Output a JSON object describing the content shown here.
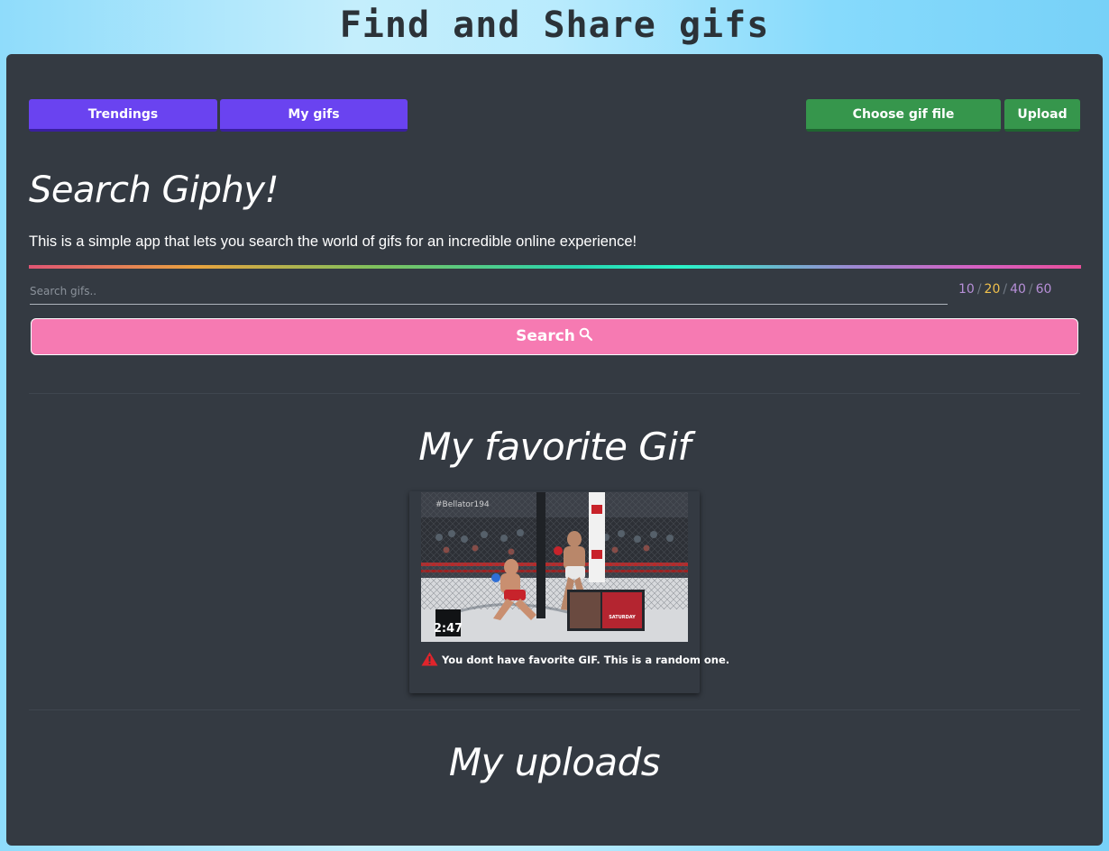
{
  "app": {
    "title": "Find and Share gifs"
  },
  "toolbar": {
    "trendings_label": "Trendings",
    "my_gifs_label": "My gifs",
    "choose_file_label": "Choose gif file",
    "upload_label": "Upload"
  },
  "search": {
    "title": "Search Giphy!",
    "intro": "This is a simple app that lets you search the world of gifs for an incredible online experience!",
    "placeholder": "Search gifs..",
    "value": "",
    "button_label": "Search",
    "limits": [
      {
        "label": "10",
        "active": false
      },
      {
        "label": "20",
        "active": true
      },
      {
        "label": "40",
        "active": false
      },
      {
        "label": "60",
        "active": false
      }
    ],
    "limit_separator": "/"
  },
  "favorite": {
    "title": "My favorite Gif",
    "note": "You dont have favorite GIF. This is a random one.",
    "gif_overlay": {
      "hashtag": "#Bellator194",
      "timer": "2:47",
      "promo_day": "SATURDAY"
    }
  },
  "uploads": {
    "title": "My uploads"
  },
  "colors": {
    "panel": "#343a42",
    "button_purple": "#6a43f0",
    "button_green": "#36964c",
    "search_button": "#f67ab2",
    "limit_active": "#f0c04c",
    "limit_inactive": "#b78fd8",
    "warning": "#e0242b"
  },
  "icons": {
    "search_button_icon": "search-icon",
    "note_icon": "warning-icon"
  }
}
